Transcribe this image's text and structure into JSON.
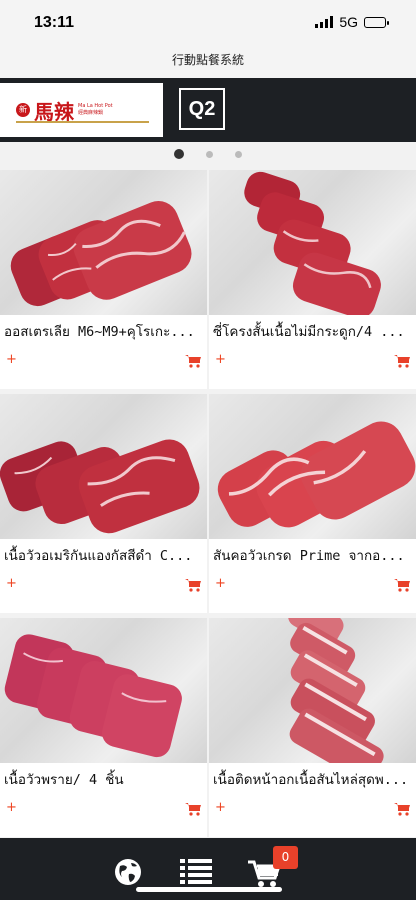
{
  "status_bar": {
    "time": "13:11",
    "network": "5G"
  },
  "app_title": "行動點餐系統",
  "banner": {
    "logo_cn": "馬辣",
    "table_code": "Q2"
  },
  "carousel": {
    "count": 3,
    "active": 0
  },
  "products": [
    {
      "name": "ออสเตรเลีย M6~M9+คุโรเกะ...",
      "add": "+"
    },
    {
      "name": "ซี่โครงสั้นเนื้อไม่มีกระดูก/4 ...",
      "add": "+"
    },
    {
      "name": "เนื้อวัวอเมริกันแองกัสสีดำ C...",
      "add": "+"
    },
    {
      "name": "สันคอวัวเกรด Prime จากอ...",
      "add": "+"
    },
    {
      "name": "เนื้อวัวพราย/ 4 ชิ้น",
      "add": "+"
    },
    {
      "name": "เนื้อติดหน้าอกเนื้อสันไหล่สุดพ...",
      "add": "+"
    }
  ],
  "bottom_nav": {
    "cart_count": "0"
  },
  "colors": {
    "accent": "#e8412a",
    "dark": "#1d2024"
  }
}
